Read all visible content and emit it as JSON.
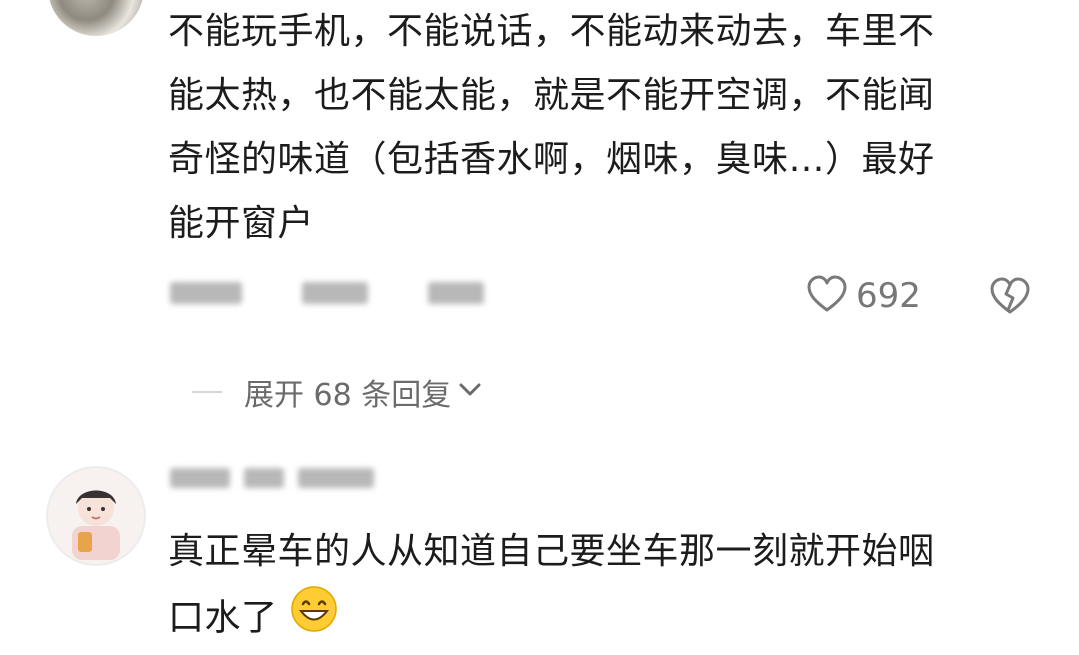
{
  "comment1": {
    "lines": [
      "不能玩手机，不能说话，不能动来动去，车里不",
      "能太热，也不能太能，就是不能开空调，不能闻",
      "奇怪的味道（包括香水啊，烟味，臭味…）最好",
      "能开窗户"
    ],
    "like_count": "692"
  },
  "replies": {
    "label": "展开 68 条回复"
  },
  "comment2": {
    "lines": [
      "真正晕车的人从知道自己要坐车那一刻就开始咽",
      "口水了"
    ]
  },
  "icons": {
    "like": "heart-outline-icon",
    "dislike": "broken-heart-icon",
    "expand": "chevron-down-icon",
    "emoji": "grinning-face-emoji"
  },
  "colors": {
    "text": "#1c1c1c",
    "muted": "#6b6b6b",
    "count": "#777777"
  }
}
